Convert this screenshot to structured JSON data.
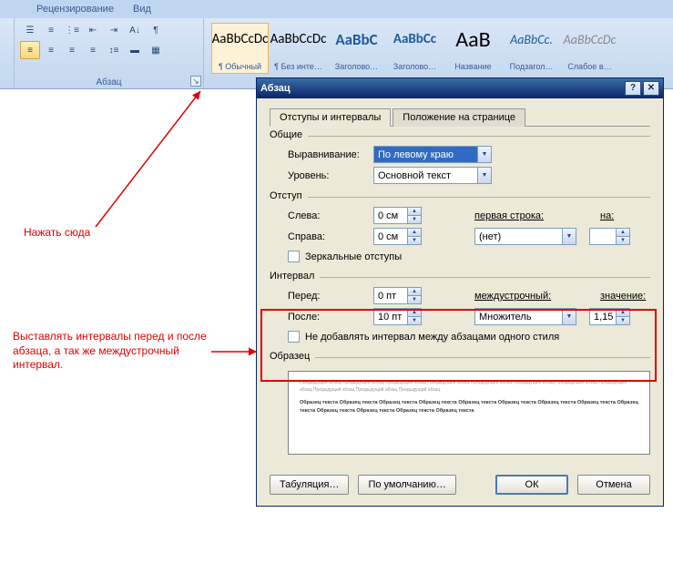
{
  "ribbon": {
    "tabs": [
      "Рецензирование",
      "Вид"
    ],
    "group_paragraph": "Абзац",
    "styles": [
      {
        "preview": "AaBbCcDc",
        "label": "¶ Обычный",
        "color": "#000",
        "italic": false,
        "bold": false,
        "size": 15,
        "selected": true
      },
      {
        "preview": "AaBbCcDc",
        "label": "¶ Без инте…",
        "color": "#000",
        "italic": false,
        "bold": false,
        "size": 15,
        "selected": false
      },
      {
        "preview": "AaBbC",
        "label": "Заголово…",
        "color": "#1f5a9a",
        "italic": false,
        "bold": true,
        "size": 17,
        "selected": false
      },
      {
        "preview": "AaBbCc",
        "label": "Заголово…",
        "color": "#1f5a9a",
        "italic": false,
        "bold": true,
        "size": 15,
        "selected": false
      },
      {
        "preview": "AaB",
        "label": "Название",
        "color": "#000",
        "italic": false,
        "bold": false,
        "size": 24,
        "selected": false
      },
      {
        "preview": "AaBbCc.",
        "label": "Подзагол…",
        "color": "#1f5a9a",
        "italic": true,
        "bold": false,
        "size": 14,
        "selected": false
      },
      {
        "preview": "AaBbCcDc",
        "label": "Слабое в…",
        "color": "#888",
        "italic": true,
        "bold": false,
        "size": 14,
        "selected": false
      }
    ]
  },
  "annotations": {
    "click_here": "Нажать сюда",
    "intervals_note": "Выставлять интервалы перед и после абзаца, а так же междустрочный интервал."
  },
  "dialog": {
    "title": "Абзац",
    "tab_indent": "Отступы и интервалы",
    "tab_position": "Положение на странице",
    "group_general": "Общие",
    "alignment_label": "Выравнивание:",
    "alignment_value": "По левому краю",
    "level_label": "Уровень:",
    "level_value": "Основной текст",
    "group_indent": "Отступ",
    "left_label": "Слева:",
    "left_value": "0 см",
    "right_label": "Справа:",
    "right_value": "0 см",
    "first_line_label": "первая строка:",
    "first_line_value": "(нет)",
    "on_label": "на:",
    "on_value": "",
    "mirror_label": "Зеркальные отступы",
    "group_spacing": "Интервал",
    "before_label": "Перед:",
    "before_value": "0 пт",
    "after_label": "После:",
    "after_value": "10 пт",
    "line_spacing_label": "междустрочный:",
    "line_spacing_value": "Множитель",
    "value_label": "значение:",
    "value_value": "1,15",
    "no_space_label": "Не добавлять интервал между абзацами одного стиля",
    "group_preview": "Образец",
    "btn_tabs": "Табуляция…",
    "btn_default": "По умолчанию…",
    "btn_ok": "ОК",
    "btn_cancel": "Отмена"
  }
}
